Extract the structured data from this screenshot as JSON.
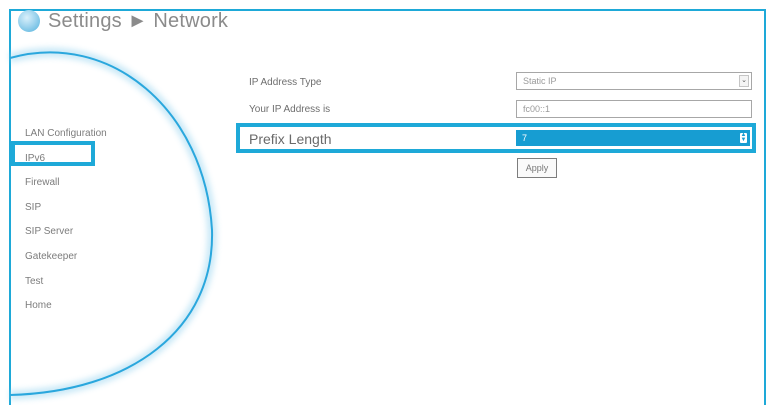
{
  "header": {
    "title": "Settings ► Network",
    "icon": "globe-icon"
  },
  "sidebar": {
    "items": [
      {
        "label": "LAN Configuration"
      },
      {
        "label": "IPv6",
        "selected": true
      },
      {
        "label": "Firewall"
      },
      {
        "label": "SIP"
      },
      {
        "label": "SIP Server"
      },
      {
        "label": "Gatekeeper"
      },
      {
        "label": "Test"
      },
      {
        "label": "Home"
      }
    ]
  },
  "form": {
    "ip_type": {
      "label": "IP Address Type",
      "value": "Static IP"
    },
    "ip_address": {
      "label": "Your IP Address is",
      "value": "fc00::1"
    },
    "prefix_length": {
      "label": "Prefix Length",
      "value": "7"
    },
    "apply_label": "Apply"
  },
  "colors": {
    "accent": "#1ea9d8",
    "selected_field": "#179dd2"
  }
}
